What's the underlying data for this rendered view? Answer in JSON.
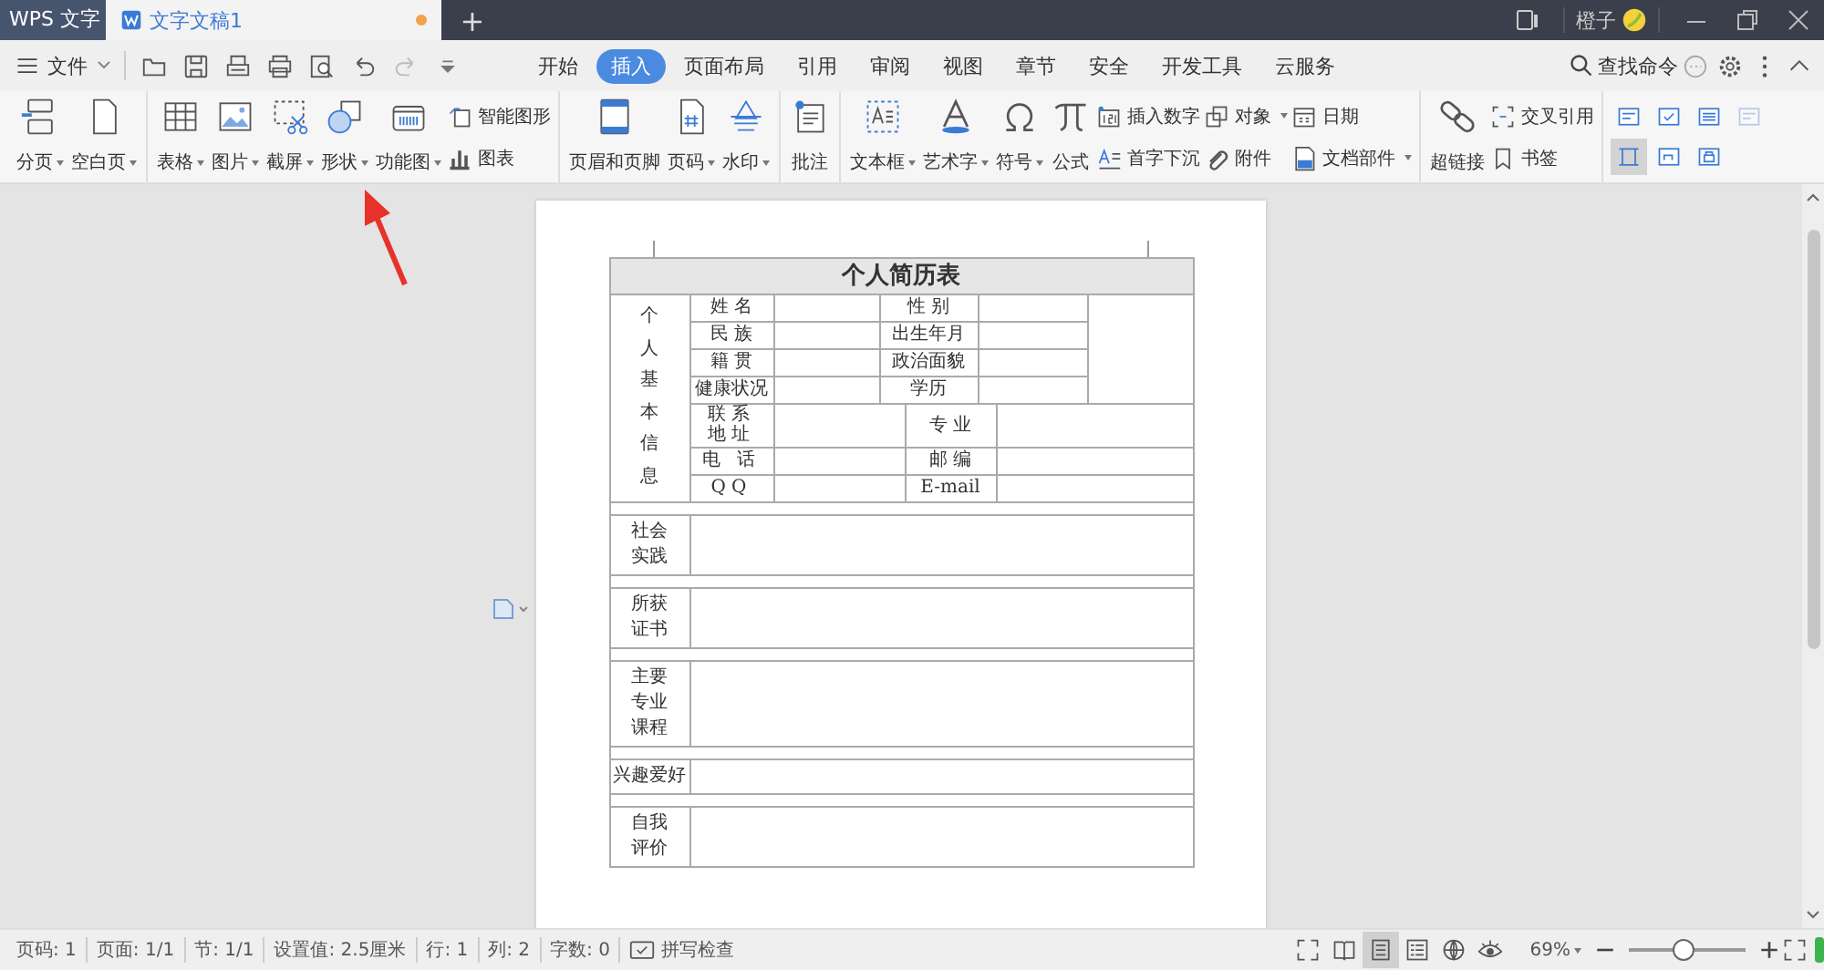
{
  "title_bar": {
    "app_tab": "WPS 文字",
    "doc_tab": {
      "label": "文字文稿1",
      "modified": true
    },
    "new_tab": "+",
    "user": "橙子"
  },
  "menu": {
    "file": "文件",
    "tabs": [
      {
        "label": "开始",
        "selected": false
      },
      {
        "label": "插入",
        "selected": true
      },
      {
        "label": "页面布局",
        "selected": false
      },
      {
        "label": "引用",
        "selected": false
      },
      {
        "label": "审阅",
        "selected": false
      },
      {
        "label": "视图",
        "selected": false
      },
      {
        "label": "章节",
        "selected": false
      },
      {
        "label": "安全",
        "selected": false
      },
      {
        "label": "开发工具",
        "selected": false
      },
      {
        "label": "云服务",
        "selected": false
      }
    ],
    "search": "查找命令"
  },
  "ribbon": [
    {
      "items": [
        {
          "kind": "large",
          "label": "分页",
          "dropdown": true
        },
        {
          "kind": "large",
          "label": "空白页",
          "dropdown": true
        }
      ]
    },
    {
      "items": [
        {
          "kind": "large",
          "label": "表格",
          "dropdown": true
        },
        {
          "kind": "large",
          "label": "图片",
          "dropdown": true
        },
        {
          "kind": "large",
          "label": "截屏",
          "dropdown": true
        },
        {
          "kind": "large",
          "label": "形状",
          "dropdown": true
        },
        {
          "kind": "large",
          "label": "功能图",
          "dropdown": true
        },
        {
          "kind": "stack",
          "items": [
            {
              "label": "智能图形",
              "dropdown": false
            },
            {
              "label": "图表",
              "dropdown": false
            }
          ]
        }
      ]
    },
    {
      "items": [
        {
          "kind": "large",
          "label": "页眉和页脚",
          "dropdown": false
        },
        {
          "kind": "large",
          "label": "页码",
          "dropdown": true
        },
        {
          "kind": "large",
          "label": "水印",
          "dropdown": true
        }
      ]
    },
    {
      "items": [
        {
          "kind": "large",
          "label": "批注",
          "dropdown": false
        }
      ]
    },
    {
      "items": [
        {
          "kind": "large",
          "label": "文本框",
          "dropdown": true
        },
        {
          "kind": "large",
          "label": "艺术字",
          "dropdown": true
        },
        {
          "kind": "large",
          "label": "符号",
          "dropdown": true
        },
        {
          "kind": "large",
          "label": "公式",
          "dropdown": false
        },
        {
          "kind": "stack",
          "items": [
            {
              "label": "插入数字",
              "dropdown": false
            },
            {
              "label": "首字下沉",
              "dropdown": false
            }
          ]
        },
        {
          "kind": "stack",
          "items": [
            {
              "label": "对象",
              "dropdown": true
            },
            {
              "label": "附件",
              "dropdown": false
            }
          ]
        },
        {
          "kind": "stack",
          "items": [
            {
              "label": "日期",
              "dropdown": false
            },
            {
              "label": "文档部件",
              "dropdown": true
            }
          ]
        }
      ]
    },
    {
      "items": [
        {
          "kind": "large",
          "label": "超链接",
          "dropdown": false
        },
        {
          "kind": "stack",
          "items": [
            {
              "label": "交叉引用",
              "dropdown": false
            },
            {
              "label": "书签",
              "dropdown": false
            }
          ]
        }
      ]
    }
  ],
  "view_buttons": [
    {
      "selected": false,
      "disabled": false
    },
    {
      "selected": false,
      "disabled": false
    },
    {
      "selected": false,
      "disabled": false
    },
    {
      "selected": false,
      "disabled": true
    },
    {
      "selected": true,
      "disabled": false
    },
    {
      "selected": false,
      "disabled": false
    },
    {
      "selected": false,
      "disabled": false
    }
  ],
  "resume": {
    "title": "个人简历表",
    "side_label": "个人基本信息",
    "upper_rows": [
      {
        "labels": [
          "姓 名",
          "性 别"
        ]
      },
      {
        "labels": [
          "民 族",
          "出生年月"
        ]
      },
      {
        "labels": [
          "籍 贯",
          "政治面貌"
        ]
      },
      {
        "labels": [
          "健康状况",
          "学历"
        ]
      }
    ],
    "lower_rows": [
      {
        "labels": [
          "联系地址",
          "专 业"
        ]
      },
      {
        "labels": [
          "电 话",
          "邮 编"
        ]
      },
      {
        "labels": [
          "QQ",
          "E-mail"
        ]
      }
    ],
    "sections": [
      {
        "label": "社会实践",
        "kind": "stacked"
      },
      {
        "label": "所获证书",
        "kind": "stacked"
      },
      {
        "label": "主要专业课程",
        "kind": "stacked"
      },
      {
        "label": "兴趣爱好",
        "kind": "inline"
      },
      {
        "label": "自我评价",
        "kind": "stacked"
      }
    ]
  },
  "status_bar": {
    "items": [
      "页码: 1",
      "页面: 1/1",
      "节: 1/1",
      "设置值: 2.5厘米",
      "行: 1",
      "列: 2",
      "字数: 0"
    ],
    "spell_check": "拼写检查",
    "views": [
      {
        "selected": false
      },
      {
        "selected": false
      },
      {
        "selected": true
      },
      {
        "selected": false
      },
      {
        "selected": false
      },
      {
        "selected": false
      }
    ],
    "zoom": "69%",
    "zoom_slider": {
      "level": 0.47
    }
  }
}
